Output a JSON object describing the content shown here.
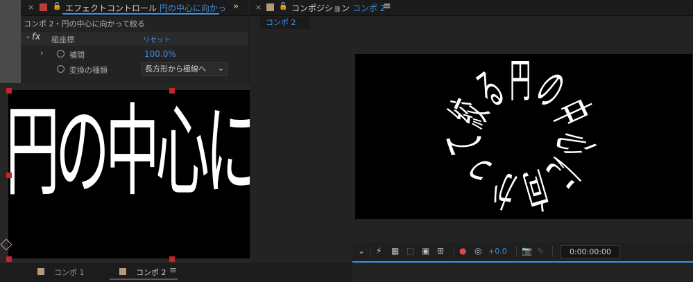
{
  "effect_panel": {
    "close_label": "×",
    "tab_title": "エフェクトコントロール",
    "tab_layer": "円の中心に向かっ",
    "more_label": "»",
    "subtitle": "コンポ 2・円の中心に向かって絞る",
    "effect": {
      "fx_label": "fx",
      "name": "極座標",
      "reset_label": "リセット"
    },
    "params": [
      {
        "name": "補間",
        "value": "100.0%"
      },
      {
        "name": "変換の種類",
        "value": "長方形から極線へ"
      }
    ]
  },
  "layer_text": "円の中心に向かって絞る",
  "comp_panel": {
    "close_label": "×",
    "tab_prefix": "コンポジション",
    "tab_comp": "コンポ 2",
    "menu_label": "≡",
    "subtab": "コンポ 2"
  },
  "viewer_text": {
    "swirl_chars": [
      "円",
      "の",
      "中",
      "心",
      "に",
      "向",
      "か",
      "っ",
      "て",
      "絞",
      "る"
    ]
  },
  "toolbar": {
    "exposure": "+0.0",
    "timecode": "0:00:00:00"
  },
  "bottom_tabs": [
    {
      "label": "コンポ 1"
    },
    {
      "label": "コンポ 2"
    }
  ],
  "bottom_menu": "≡",
  "colors": {
    "accent_blue": "#3d8fe0",
    "handle_red": "#c0262a",
    "comp_swatch": "#b39a78",
    "effect_swatch": "#c23b3b"
  }
}
